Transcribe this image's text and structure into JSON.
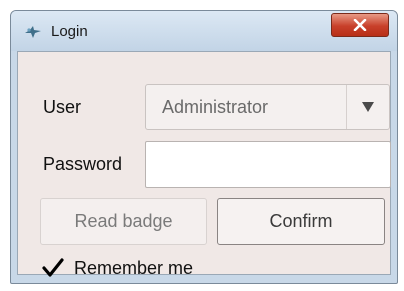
{
  "window": {
    "title": "Login",
    "close_icon": "close-icon",
    "app_icon": "app-icon"
  },
  "form": {
    "user_label": "User",
    "user_value": "Administrator",
    "password_label": "Password",
    "password_value": "",
    "read_badge_label": "Read badge",
    "confirm_label": "Confirm",
    "remember_label": "Remember me",
    "remember_checked": true
  },
  "colors": {
    "close_button": "#c8402a",
    "titlebar": "#c8d8e8",
    "client_bg": "#f0e8e6"
  }
}
